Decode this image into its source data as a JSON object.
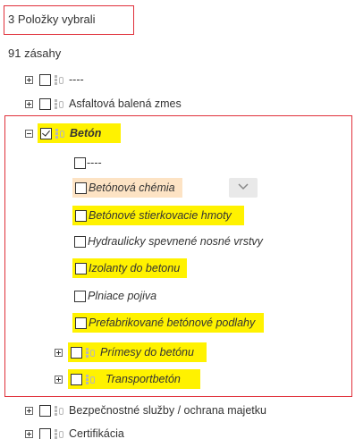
{
  "summary": {
    "selected_text": "3 Položky vybrali",
    "hits_text": "91 zásahy"
  },
  "tree": {
    "items": [
      {
        "label": "----"
      },
      {
        "label": "Asfaltová balená zmes"
      },
      {
        "label": "Betón"
      },
      {
        "label": "----"
      },
      {
        "label": "Betónová chémia"
      },
      {
        "label": "Betónové stierkovacie hmoty"
      },
      {
        "label": "Hydraulicky spevnené nosné vrstvy"
      },
      {
        "label": "Izolanty do betonu"
      },
      {
        "label": "Plniace pojiva"
      },
      {
        "label": "Prefabrikované betónové podlahy"
      },
      {
        "label": "Prímesy do betónu"
      },
      {
        "label": "Transportbetón"
      },
      {
        "label": "Bezpečnostné služby / ochrana majetku"
      },
      {
        "label": "Certifikácia"
      }
    ]
  },
  "colors": {
    "highlight": "#fff200",
    "hover": "#fde3c4",
    "frame": "#e0303a"
  },
  "icons": [
    "expand-icon",
    "collapse-icon",
    "checkbox",
    "category-icon",
    "chevron-down-icon"
  ]
}
